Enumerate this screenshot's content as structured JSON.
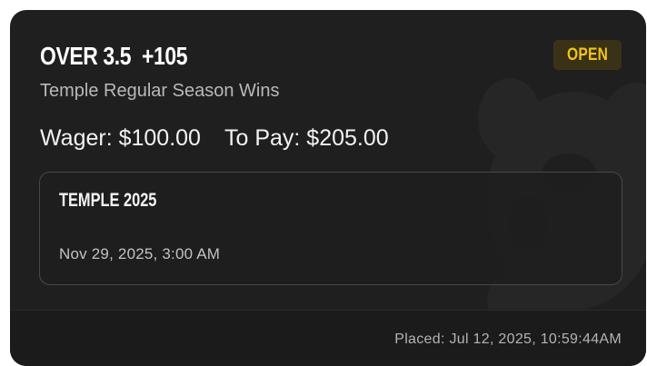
{
  "bet": {
    "title": "OVER 3.5  +105",
    "status": "OPEN",
    "market": "Temple Regular Season Wins",
    "wager": "Wager: $100.00",
    "to_pay": "To Pay: $205.00"
  },
  "leg": {
    "title": "TEMPLE 2025",
    "date": "Nov 29, 2025, 3:00 AM"
  },
  "footer": {
    "placed": "Placed: Jul 12, 2025, 10:59:44AM"
  },
  "colors": {
    "card_background": "#1f1f20",
    "status_text": "#f2c418",
    "status_background": "#3a3217"
  },
  "icons": {
    "watermark": "team-logo-watermark-icon"
  }
}
